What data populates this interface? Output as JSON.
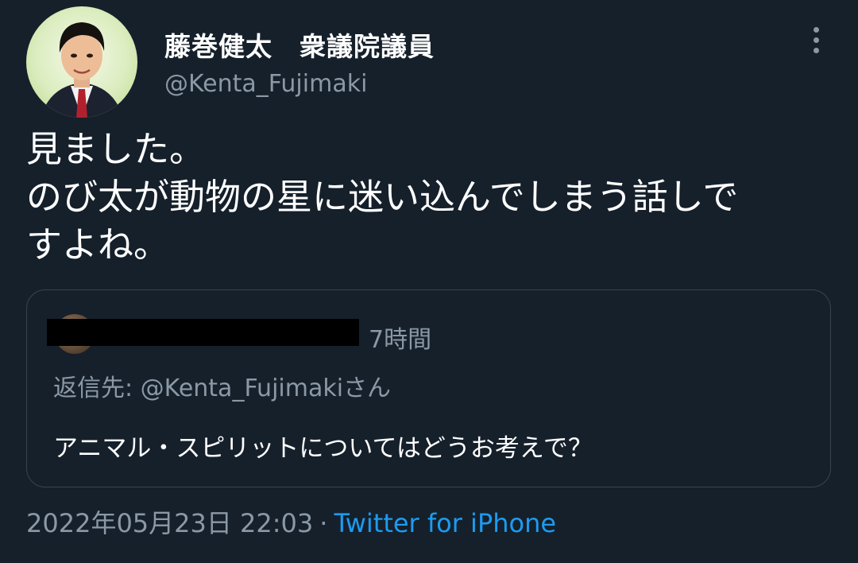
{
  "author": {
    "display_name": "藤巻健太　衆議院議員",
    "handle": "@Kenta_Fujimaki"
  },
  "tweet": {
    "lines": [
      "見ました。",
      "のび太が動物の星に迷い込んでしまう話しで",
      "すよね。"
    ]
  },
  "quoted_tweet": {
    "time": "7時間",
    "reply_to": "返信先: @Kenta_Fujimakiさん",
    "text": "アニマル・スピリットについてはどうお考えで？"
  },
  "meta": {
    "timestamp": "2022年05月23日 22:03",
    "separator": "·",
    "source": "Twitter for iPhone"
  },
  "icons": {
    "more": "more-vertical-icon"
  },
  "colors": {
    "background": "#15202b",
    "secondary_text": "#8b98a5",
    "link": "#1d9bf0",
    "border": "#38444d"
  }
}
